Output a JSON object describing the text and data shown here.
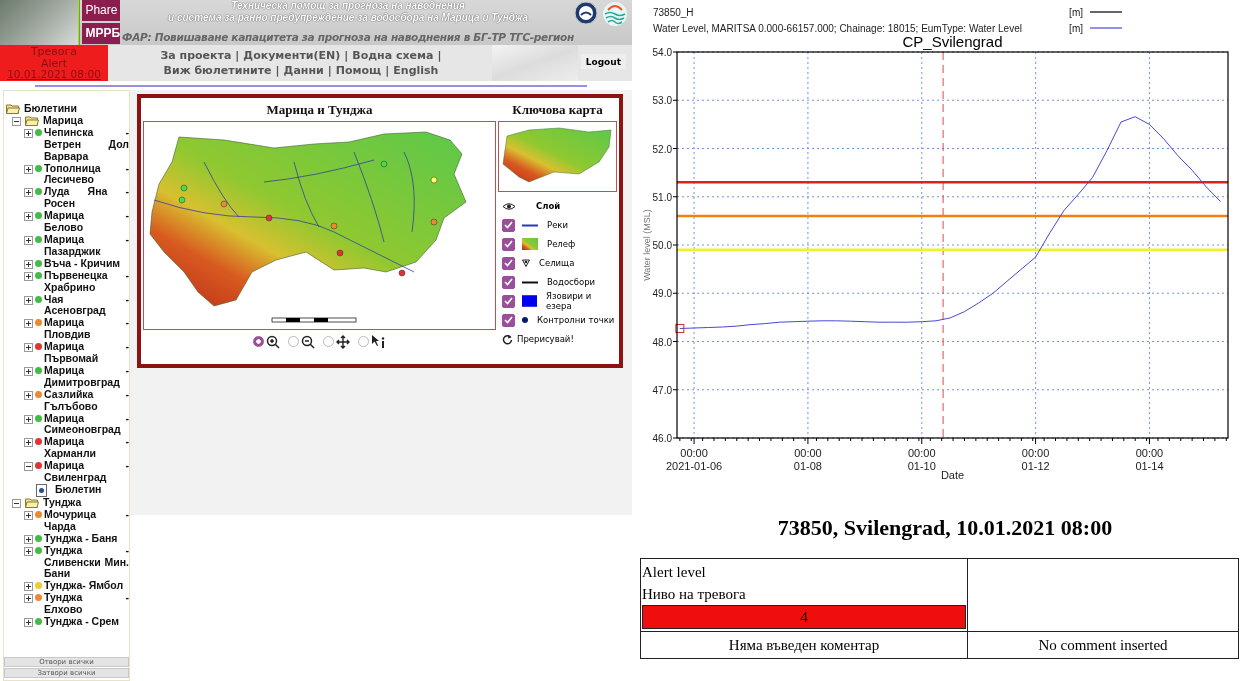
{
  "header": {
    "title_lines": [
      "Техническа помощ за прогноза на наводнения",
      "и система за ранно предупреждение за водосбора на Марица и Тунджа"
    ],
    "subtitle": "ФАР: Повишаване капацитета за прогноза на наводнения в БГ-ТР ТГС-регион",
    "logos": [
      "Phare",
      "МРРБ"
    ],
    "alert": {
      "lines": [
        "Тревога",
        "Alert"
      ],
      "date": "10.01.2021 08:00"
    },
    "nav": {
      "separator": "|",
      "links": [
        "За проекта",
        "Документи(EN)",
        "Водна схема",
        "Виж бюлетините",
        "Данни",
        "Помощ",
        "English"
      ]
    },
    "logout": "Logout"
  },
  "sidebar": {
    "tree": [
      {
        "kind": "folder",
        "label": "Бюлетини",
        "expanded": true,
        "children": [
          {
            "kind": "folder",
            "label": "Марица",
            "expanded": true,
            "children": [
              {
                "kind": "station",
                "label": "Чепинска - Ветрен Дол Варвара",
                "color": "#44bb44",
                "expanded": false
              },
              {
                "kind": "station",
                "label": "Тополница - Лесичево",
                "color": "#44bb44",
                "expanded": false
              },
              {
                "kind": "station",
                "label": "Луда Яна - Росен",
                "color": "#44bb44",
                "expanded": false
              },
              {
                "kind": "station",
                "label": "Марица - Белово",
                "color": "#44bb44",
                "expanded": false
              },
              {
                "kind": "station",
                "label": "Марица - Пазарджик",
                "color": "#44bb44",
                "expanded": false
              },
              {
                "kind": "station",
                "label": "Въча - Кричим",
                "color": "#44bb44",
                "expanded": false
              },
              {
                "kind": "station",
                "label": "Първенецка - Храбрино",
                "color": "#44bb44",
                "expanded": false
              },
              {
                "kind": "station",
                "label": "Чая - Асеновград",
                "color": "#44bb44",
                "expanded": false
              },
              {
                "kind": "station",
                "label": "Марица - Пловдив",
                "color": "#ee8833",
                "expanded": false
              },
              {
                "kind": "station",
                "label": "Марица - Първомай",
                "color": "#e03333",
                "expanded": false
              },
              {
                "kind": "station",
                "label": "Марица - Димитровград",
                "color": "#44bb44",
                "expanded": false
              },
              {
                "kind": "station",
                "label": "Сазлийка - Гълъбово",
                "color": "#ee8833",
                "expanded": false
              },
              {
                "kind": "station",
                "label": "Марица - Симеоновград",
                "color": "#44bb44",
                "expanded": false
              },
              {
                "kind": "station",
                "label": "Марица - Харманли",
                "color": "#e03333",
                "expanded": false
              },
              {
                "kind": "station",
                "label": "Марица - Свиленград",
                "color": "#e03333",
                "expanded": true,
                "children": [
                  {
                    "kind": "document",
                    "label": "Бюлетин"
                  }
                ]
              }
            ]
          },
          {
            "kind": "folder",
            "label": "Тунджа",
            "expanded": true,
            "children": [
              {
                "kind": "station",
                "label": "Мочурица - Чарда",
                "color": "#ee8833",
                "expanded": false
              },
              {
                "kind": "station",
                "label": "Тунджа - Баня",
                "color": "#44bb44",
                "expanded": false
              },
              {
                "kind": "station",
                "label": "Тунджа - Сливенски Мин. Бани",
                "color": "#44bb44",
                "expanded": false
              },
              {
                "kind": "station",
                "label": "Тунджа- Ямбол",
                "color": "#eecc33",
                "expanded": false
              },
              {
                "kind": "station",
                "label": "Тунджа - Елхово",
                "color": "#ee8833",
                "expanded": false
              },
              {
                "kind": "station",
                "label": "Тунджа - Срем",
                "color": "#44bb44",
                "expanded": false
              }
            ]
          }
        ]
      }
    ],
    "buttons": [
      "Отвори всички",
      "Затвори всички"
    ]
  },
  "map": {
    "title": "Марица и Тунджа",
    "key_map_title": "Ключова карта",
    "tools": [
      {
        "kind": "zoom-in",
        "selected": true
      },
      {
        "kind": "zoom-out",
        "selected": false
      },
      {
        "kind": "pan",
        "selected": false
      },
      {
        "kind": "info",
        "selected": false
      }
    ],
    "layers_header": "Слой",
    "layers": [
      {
        "kind": "river",
        "label": "Реки",
        "checked": true
      },
      {
        "kind": "relief",
        "label": "Релеф",
        "checked": true
      },
      {
        "kind": "settlement",
        "label": "Селища",
        "checked": true
      },
      {
        "kind": "catchment",
        "label": "Водосбори",
        "checked": true
      },
      {
        "kind": "reservoir",
        "label": "Язовири и езера",
        "checked": true
      },
      {
        "kind": "checkpoint",
        "label": "Контролни точки",
        "checked": true
      }
    ],
    "redraw": "Прерисувай!"
  },
  "chart": {
    "chart_data": {
      "type": "line",
      "title": "CP_Svilengrad",
      "xlabel": "Date",
      "categories": [
        null,
        "00:00\n2021-01-06",
        null,
        null,
        null,
        null,
        null,
        null,
        null,
        "00:00\n01-08",
        null,
        null,
        null,
        null,
        null,
        null,
        null,
        "00:00\n01-10",
        null,
        null,
        null,
        null,
        null,
        null,
        null,
        "00:00\n01-12",
        null,
        null,
        null,
        null,
        null,
        null,
        null,
        "00:00\n01-14",
        null,
        null,
        null,
        null,
        null
      ],
      "series": [
        {
          "name": "73850_H",
          "color": "#000000",
          "values": [
            null,
            null,
            null,
            null,
            null,
            null,
            null,
            null,
            null,
            null,
            null,
            null,
            null,
            null,
            null,
            null,
            null,
            null,
            null,
            null,
            null,
            null,
            null,
            null,
            null,
            null,
            null,
            null,
            null,
            null,
            null,
            null,
            null,
            null,
            null,
            null,
            null,
            null,
            null
          ]
        },
        {
          "name": "Water Level, MARITSA 0.000-66157.000; Chainage: 18015; EumType: Water Level",
          "color": "#4848d8",
          "values": [
            48.27,
            48.28,
            48.29,
            48.3,
            48.32,
            48.35,
            48.37,
            48.4,
            48.41,
            48.42,
            48.43,
            48.43,
            48.42,
            48.41,
            48.4,
            48.4,
            48.4,
            48.41,
            48.43,
            48.49,
            48.62,
            48.8,
            49.0,
            49.25,
            49.5,
            49.75,
            50.25,
            50.72,
            51.05,
            51.4,
            51.95,
            52.55,
            52.66,
            52.5,
            52.2,
            51.85,
            51.55,
            51.2,
            50.9
          ]
        }
      ],
      "ylim": [
        46,
        54
      ],
      "yticks": [
        {
          "value": 46,
          "label": "46.0"
        },
        {
          "value": 47,
          "label": "47.0"
        },
        {
          "value": 48,
          "label": "48.0"
        },
        {
          "value": 49,
          "label": "49.0"
        },
        {
          "value": 50,
          "label": "50.0"
        },
        {
          "value": 51,
          "label": "51.0"
        },
        {
          "value": 52,
          "label": "52.0"
        },
        {
          "value": 53,
          "label": "53.0"
        },
        {
          "value": 54,
          "label": "54.0"
        }
      ],
      "ylabel": "Water level (MSL)",
      "grid": true,
      "ref_lines": [
        {
          "axis": "y",
          "value": 51.3,
          "color": "#e02020"
        },
        {
          "axis": "y",
          "value": 50.6,
          "color": "#f08010"
        },
        {
          "axis": "y",
          "value": 49.9,
          "color": "#f0f030"
        }
      ]
    },
    "legend_units": [
      "[m]",
      "[m]"
    ]
  },
  "report": {
    "heading": "73850, Svilengrad, 10.01.2021 08:00",
    "alert_labels": [
      "Alert level",
      "Ниво на тревога"
    ],
    "alert_value": "4",
    "comments": [
      "Няма въведен коментар",
      "No comment inserted"
    ]
  }
}
